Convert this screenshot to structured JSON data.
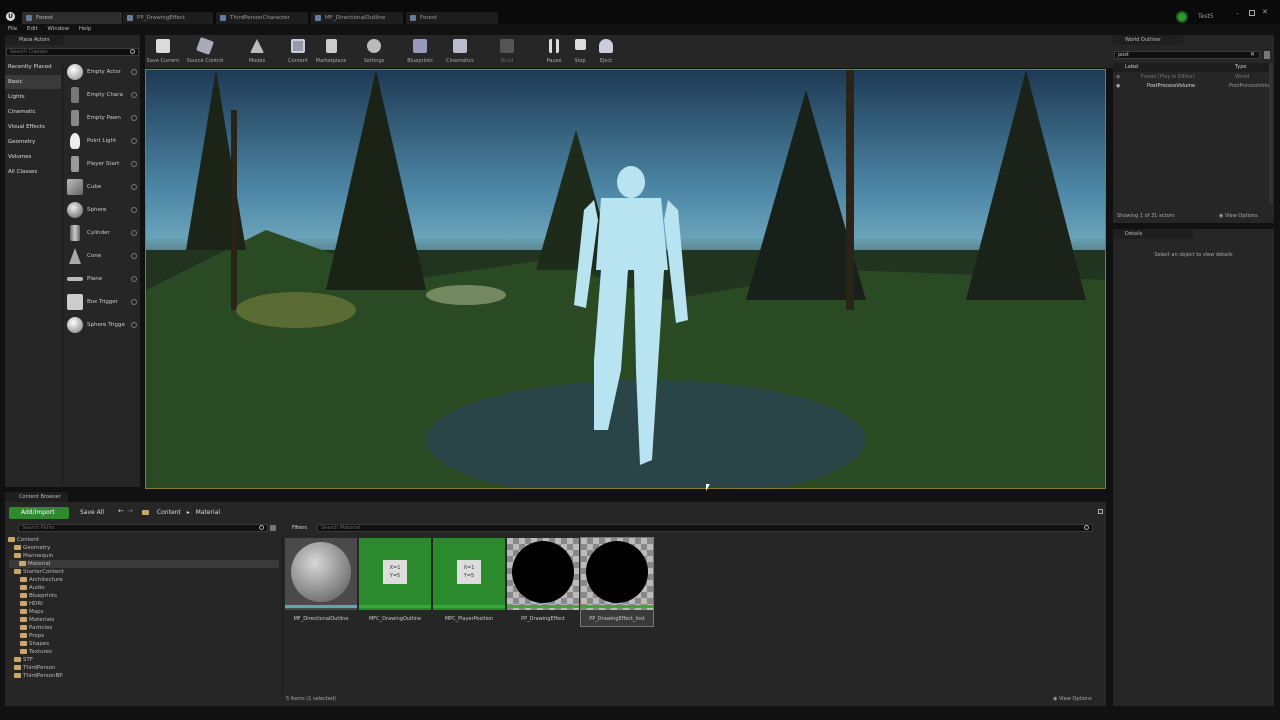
{
  "tabs": [
    {
      "label": "Forest"
    },
    {
      "label": "PP_DrawingEffect"
    },
    {
      "label": "ThirdPersonCharacter"
    },
    {
      "label": "MF_DirectionalOutline"
    },
    {
      "label": "Forest"
    }
  ],
  "user": "Test5",
  "menu": {
    "file": "File",
    "edit": "Edit",
    "window": "Window",
    "help": "Help"
  },
  "place_actors": {
    "title": "Place Actors",
    "search_placeholder": "Search Classes",
    "categories": [
      "Recently Placed",
      "Basic",
      "Lights",
      "Cinematic",
      "Visual Effects",
      "Geometry",
      "Volumes",
      "All Classes"
    ],
    "items": [
      "Empty Actor",
      "Empty Chara",
      "Empty Pawn",
      "Point Light",
      "Player Start",
      "Cube",
      "Sphere",
      "Cylinder",
      "Cone",
      "Plane",
      "Box Trigger",
      "Sphere Trigge"
    ]
  },
  "toolbar": {
    "save_current": "Save Current",
    "source_control": "Source Control",
    "modes": "Modes",
    "content": "Content",
    "marketplace": "Marketplace",
    "settings": "Settings",
    "blueprints": "Blueprints",
    "cinematics": "Cinematics",
    "build": "Build",
    "pause": "Pause",
    "stop": "Stop",
    "eject": "Eject"
  },
  "content_browser": {
    "tab": "Content Browser",
    "add_import": "Add/Import",
    "save_all": "Save All",
    "crumb_root": "Content",
    "crumb_leaf": "Material",
    "search_paths": "Search Paths",
    "filters": "Filters",
    "search_placeholder": "Search Material",
    "status": "5 items (1 selected)",
    "view_options": "View Options",
    "tree": [
      {
        "label": "Content",
        "indent": 0
      },
      {
        "label": "Geometry",
        "indent": 1
      },
      {
        "label": "Mannequin",
        "indent": 1
      },
      {
        "label": "Material",
        "indent": 1
      },
      {
        "label": "StarterContent",
        "indent": 1
      },
      {
        "label": "Architecture",
        "indent": 2
      },
      {
        "label": "Audio",
        "indent": 2
      },
      {
        "label": "Blueprints",
        "indent": 2
      },
      {
        "label": "HDRI",
        "indent": 2
      },
      {
        "label": "Maps",
        "indent": 2
      },
      {
        "label": "Materials",
        "indent": 2
      },
      {
        "label": "Particles",
        "indent": 2
      },
      {
        "label": "Props",
        "indent": 2
      },
      {
        "label": "Shapes",
        "indent": 2
      },
      {
        "label": "Textures",
        "indent": 2
      },
      {
        "label": "STF",
        "indent": 1
      },
      {
        "label": "ThirdPerson",
        "indent": 1
      },
      {
        "label": "ThirdPersonBP",
        "indent": 1
      }
    ],
    "assets": [
      {
        "name": "MF_DirectionalOutline",
        "kind": "sphere",
        "bar": "#5ca6b0"
      },
      {
        "name": "MFC_DrawingOutline",
        "kind": "param",
        "bar": "#3aa83a",
        "text": "X=1\nY=5"
      },
      {
        "name": "MPC_PlayerPosition",
        "kind": "param",
        "bar": "#3aa83a",
        "text": "X=1\nY=5"
      },
      {
        "name": "PP_DrawingEffect",
        "kind": "black",
        "bar": "#3aa83a"
      },
      {
        "name": "PP_DrawingEffect_Inst",
        "kind": "black",
        "bar": "#3aa83a"
      }
    ]
  },
  "outliner": {
    "title": "World Outliner",
    "search_value": "post",
    "col_label": "Label",
    "col_type": "Type",
    "rows": [
      {
        "label": "Forest (Play in Editor)",
        "type": "World"
      },
      {
        "label": "PostProcessVolume",
        "type": "PostProcessVolu"
      }
    ],
    "status": "Showing 1 of 31 actors",
    "view_options": "View Options"
  },
  "details": {
    "title": "Details",
    "empty": "Select an object to view details"
  }
}
